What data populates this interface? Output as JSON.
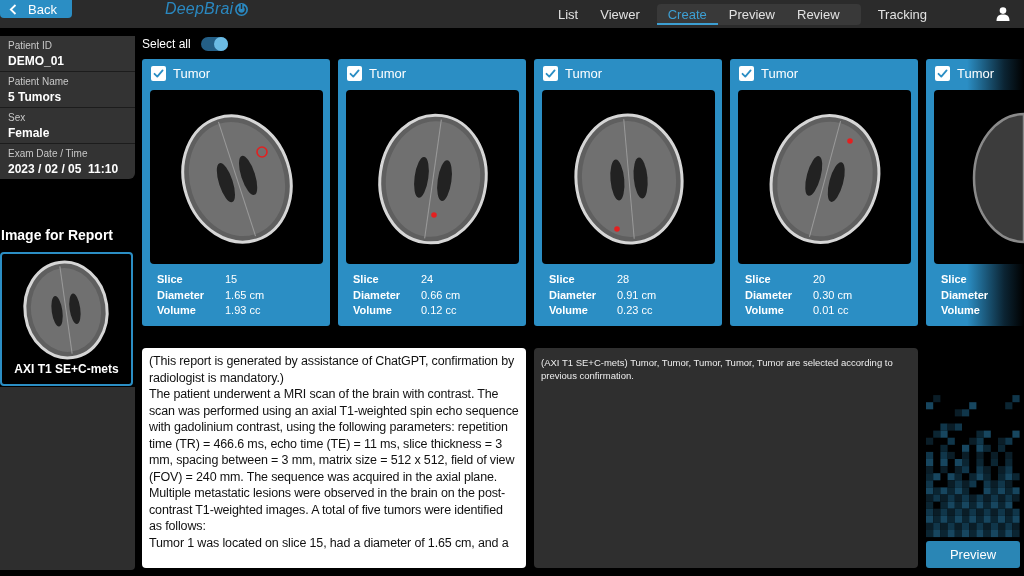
{
  "header": {
    "back_button": "Back",
    "logo_text": "DeepBrai",
    "nav_links": [
      {
        "label": "List",
        "selected": false
      },
      {
        "label": "Viewer",
        "selected": false
      }
    ],
    "workflow_tabs": [
      {
        "label": "Create",
        "selected": true
      },
      {
        "label": "Preview",
        "selected": false
      },
      {
        "label": "Review",
        "selected": false
      }
    ],
    "nav_links_right": [
      {
        "label": "Tracking",
        "selected": false
      }
    ]
  },
  "patient_info": [
    {
      "label": "Patient ID",
      "value": "DEMO_01"
    },
    {
      "label": "Patient Name",
      "value": "5 Tumors"
    },
    {
      "label": "Sex",
      "value": "Female"
    },
    {
      "label": "Exam Date / Time",
      "value": "2023 / 02 / 05  11:10"
    }
  ],
  "report_image": {
    "heading": "Image for Report",
    "series_label": "AXI T1 SE+C-mets"
  },
  "select_all": {
    "label": "Select all",
    "on": true
  },
  "tumor_cards": [
    {
      "label": "Tumor",
      "checked": true,
      "stats": [
        {
          "label": "Slice",
          "value": "15"
        },
        {
          "label": "Diameter",
          "value": "1.65 cm"
        },
        {
          "label": "Volume",
          "value": "1.93 cc"
        }
      ]
    },
    {
      "label": "Tumor",
      "checked": true,
      "stats": [
        {
          "label": "Slice",
          "value": "24"
        },
        {
          "label": "Diameter",
          "value": "0.66 cm"
        },
        {
          "label": "Volume",
          "value": "0.12 cc"
        }
      ]
    },
    {
      "label": "Tumor",
      "checked": true,
      "stats": [
        {
          "label": "Slice",
          "value": "28"
        },
        {
          "label": "Diameter",
          "value": "0.91 cm"
        },
        {
          "label": "Volume",
          "value": "0.23 cc"
        }
      ]
    },
    {
      "label": "Tumor",
      "checked": true,
      "stats": [
        {
          "label": "Slice",
          "value": "20"
        },
        {
          "label": "Diameter",
          "value": "0.30 cm"
        },
        {
          "label": "Volume",
          "value": "0.01 cc"
        }
      ]
    },
    {
      "label": "Tumor",
      "checked": true,
      "stats": [
        {
          "label": "Slice"
        },
        {
          "label": "Diameter"
        },
        {
          "label": "Volume"
        }
      ]
    }
  ],
  "report_text": "(This report is generated by assistance of ChatGPT, confirmation by radiologist is mandatory.)\nThe patient underwent a MRI scan of the brain with contrast. The scan was performed using an axial T1-weighted spin echo sequence with gadolinium contrast, using the following parameters: repetition time (TR) = 466.6 ms, echo time (TE) = 11 ms, slice thickness = 3 mm, spacing between = 3 mm, matrix size = 512 x 512, field of view (FOV) = 240 mm. The sequence was acquired in the axial plane.\nMultiple metastatic lesions were observed in the brain on the post-contrast T1-weighted images. A total of five tumors were identified as follows:\nTumor 1 was located on slice 15, had a diameter of 1.65 cm, and a",
  "selection_summary": "(AXI T1 SE+C-mets) Tumor, Tumor, Tumor, Tumor, Tumor are selected according to previous confirmation.",
  "preview_button": "Preview"
}
